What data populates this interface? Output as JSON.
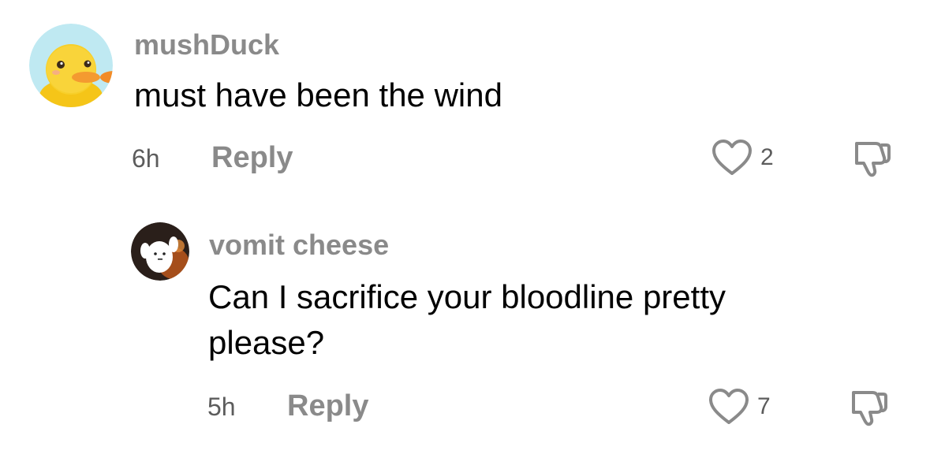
{
  "comments": [
    {
      "username": "mushDuck",
      "text": "must have been the wind",
      "time": "6h",
      "reply_label": "Reply",
      "likes": "2",
      "avatar_icon": "duck-avatar"
    }
  ],
  "replies": [
    {
      "username": "vomit cheese",
      "text": "Can I sacrifice your bloodline pretty please?",
      "time": "5h",
      "reply_label": "Reply",
      "likes": "7",
      "avatar_icon": "ghost-avatar"
    }
  ],
  "colors": {
    "username": "#8a8a8a",
    "meta": "#5c5c5c",
    "icon_stroke": "#8a8a8a"
  }
}
